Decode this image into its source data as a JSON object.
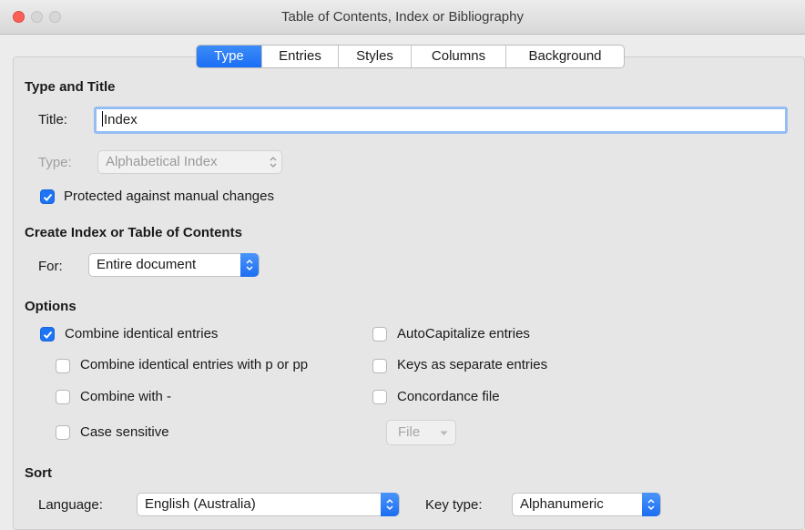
{
  "window": {
    "title": "Table of Contents, Index or Bibliography"
  },
  "tabs": [
    {
      "label": "Type",
      "active": true
    },
    {
      "label": "Entries",
      "active": false
    },
    {
      "label": "Styles",
      "active": false
    },
    {
      "label": "Columns",
      "active": false
    },
    {
      "label": "Background",
      "active": false
    }
  ],
  "type_and_title": {
    "heading": "Type and Title",
    "title_label": "Title:",
    "title_value": "Index",
    "type_label": "Type:",
    "type_value": "Alphabetical Index",
    "protected_label": "Protected against manual changes",
    "protected_checked": true
  },
  "create": {
    "heading": "Create Index or Table of Contents",
    "for_label": "For:",
    "for_value": "Entire document"
  },
  "options": {
    "heading": "Options",
    "combine_identical": {
      "label": "Combine identical entries",
      "checked": true
    },
    "combine_p_pp": {
      "label": "Combine identical entries with p or pp",
      "checked": false
    },
    "combine_with": {
      "label": "Combine with -",
      "checked": false
    },
    "case_sensitive": {
      "label": "Case sensitive",
      "checked": false
    },
    "autocapitalize": {
      "label": "AutoCapitalize entries",
      "checked": false
    },
    "keys_separate": {
      "label": "Keys as separate entries",
      "checked": false
    },
    "concordance": {
      "label": "Concordance file",
      "checked": false
    },
    "file_button": "File"
  },
  "sort": {
    "heading": "Sort",
    "language_label": "Language:",
    "language_value": "English (Australia)",
    "key_type_label": "Key type:",
    "key_type_value": "Alphanumeric"
  },
  "colors": {
    "accent": "#1d74f5",
    "traffic_close": "#fc5f57"
  }
}
